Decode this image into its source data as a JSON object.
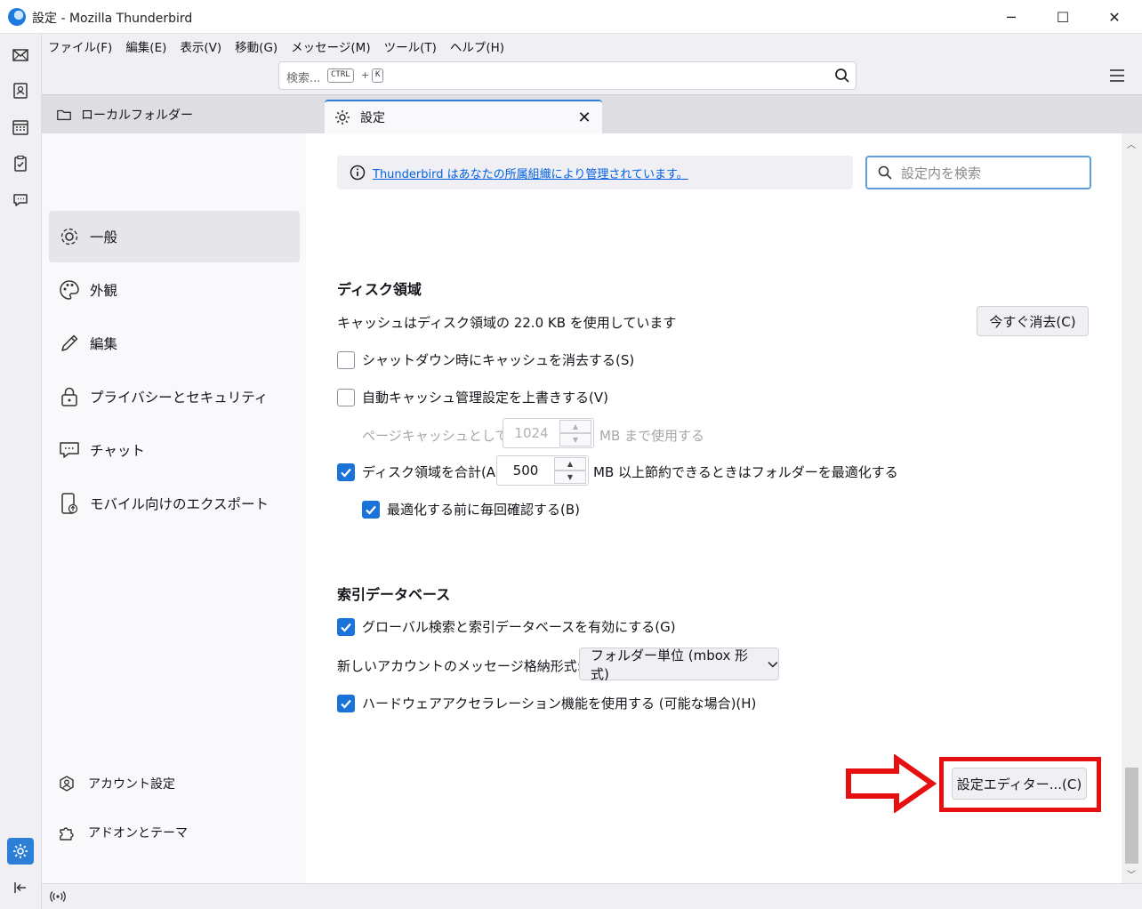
{
  "window": {
    "title": "設定 - Mozilla Thunderbird",
    "controls": {
      "minimize": "─",
      "maximize": "☐",
      "close": "✕"
    }
  },
  "menubar": [
    "ファイル(F)",
    "編集(E)",
    "表示(V)",
    "移動(G)",
    "メッセージ(M)",
    "ツール(T)",
    "ヘルプ(H)"
  ],
  "search": {
    "placeholder": "検索...",
    "kbd1": "CTRL",
    "plus": "+",
    "kbd2": "K"
  },
  "tabs": {
    "folder": "ローカルフォルダー",
    "settings": "設定",
    "close": "✕"
  },
  "nav": {
    "items": [
      "一般",
      "外観",
      "編集",
      "プライバシーとセキュリティ",
      "チャット",
      "モバイル向けのエクスポート"
    ],
    "footer": [
      "アカウント設定",
      "アドオンとテーマ"
    ]
  },
  "managed_notice": "Thunderbird はあなたの所属組織により管理されています。",
  "pref_search_placeholder": "設定内を検索",
  "disk": {
    "heading": "ディスク領域",
    "cache_text": "キャッシュはディスク領域の 22.0 KB を使用しています",
    "clear_button": "今すぐ消去(C)",
    "clear_on_shutdown": "シャットダウン時にキャッシュを消去する(S)",
    "override_cache": "自動キャッシュ管理設定を上書きする(V)",
    "page_cache_label": "ページキャッシュとして(U)",
    "page_cache_value": "1024",
    "page_cache_unit": "MB まで使用する",
    "compact_label": "ディスク領域を合計(A)",
    "compact_value": "500",
    "compact_unit": "MB 以上節約できるときはフォルダーを最適化する",
    "confirm_compact": "最適化する前に毎回確認する(B)"
  },
  "index": {
    "heading": "索引データベース",
    "global_search": "グローバル検索と索引データベースを有効にする(G)",
    "store_type_label": "新しいアカウントのメッセージ格納形式:(T)",
    "store_type_value": "フォルダー単位 (mbox 形式)",
    "hw_accel": "ハードウェアアクセラレーション機能を使用する (可能な場合)(H)",
    "config_editor_button": "設定エディター...(C)"
  },
  "checkbox_state": {
    "clear_on_shutdown": false,
    "override_cache": false,
    "compact": true,
    "confirm_compact": true,
    "global_search": true,
    "hw_accel": true
  },
  "colors": {
    "accent": "#1a73d9",
    "annotation": "#e61010",
    "link": "#0061e0"
  }
}
